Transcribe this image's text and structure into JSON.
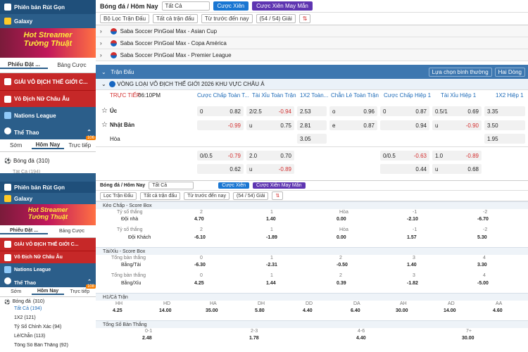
{
  "sidebar": {
    "promo": "Phiên bản Rút Gọn",
    "galaxy": "Galaxy",
    "banner_line1": "Hot Streamer",
    "banner_line2": "Tường Thuật",
    "slip_label": "Phiếu Đặt ...",
    "odds_table": "Bảng Cược",
    "menu": [
      "GIẢI VÔ ĐỊCH THẾ GIỚI C...",
      "Vô Địch Nữ Châu Âu",
      "Nations League",
      "Thể Thao"
    ],
    "subtabs": [
      "Sớm",
      "Hôm Nay",
      "Trực tiếp"
    ],
    "live_count": "106",
    "live_count2": "108",
    "sport": "Bóng đá",
    "sport_count": "(310)",
    "sport_count2": "(310)",
    "items": [
      "Tất Cả (194)",
      "1X2 (121)",
      "Tỷ Số Chính Xác (94)",
      "Lẻ/Chẵn (113)",
      "Tổng Số Bàn Thắng (92)"
    ],
    "item_partial": "Tất Cả (194)"
  },
  "toolbar": {
    "title": "Bóng đá / Hôm Nay",
    "market": "Tất Cả",
    "parlay": "Cược Xiên",
    "mix": "Cược Xiên May Mắn",
    "filter": "Bộ Lọc Trận Đấu",
    "all_matches": "Tất cả trận đấu",
    "time": "Từ trước đến nay",
    "count": "(54 / 54) Giải",
    "filter_small": "Lọc Trận Đấu",
    "all_small": "Tất cả trận đấu",
    "time_small": "Từ trước đến nay"
  },
  "leagues": [
    "Saba Soccer PinGoal Max - Asian Cup",
    "Saba Soccer PinGoal Max - Copa América",
    "Saba Soccer PinGoal Max - Premier League"
  ],
  "matches_bar": {
    "label": "Trận Đấu",
    "sort": "Lựa chọn bình thường",
    "view": "Hai Dòng"
  },
  "competition": "VÒNG LOẠI VÔ ĐỊCH THẾ GIỚI 2026 KHU VỰC CHÂU Á",
  "live": {
    "label": "TRỰC TIẾP",
    "time": "06:10PM"
  },
  "cols": [
    "Cược Chấp Toàn T...",
    "Tài Xỉu Toàn Trận",
    "1X2 Toàn...",
    "Chẵn Lẻ Toàn Trận",
    "Cược Chấp Hiệp 1",
    "Tài Xỉu Hiệp 1",
    "1X2 Hiệp 1"
  ],
  "teams": {
    "home": "Úc",
    "away": "Nhật Bản",
    "draw": "Hòa"
  },
  "row1": {
    "hcap": "0",
    "hv": "0.82",
    "ou": "2/2.5",
    "ouv": "-0.94",
    "x1": "2.53",
    "ol": "o",
    "olv": "0.96",
    "h1": "0",
    "h1v": "0.87",
    "ou1": "0.5/1",
    "ou1v": "0.69",
    "x11": "3.35"
  },
  "row2": {
    "hv": "-0.99",
    "ou": "u",
    "ouv": "0.75",
    "x1": "2.81",
    "ol": "e",
    "olv": "0.87",
    "h1v": "0.94",
    "ou1": "u",
    "ou1v": "-0.90",
    "x11": "3.50"
  },
  "row3": {
    "x1": "3.05",
    "x11": "1.95"
  },
  "row4": {
    "hcap": "0/0.5",
    "hv": "-0.79",
    "ou": "2.0",
    "ouv": "0.70",
    "h1": "0/0.5",
    "h1v": "-0.63",
    "ou1": "1.0",
    "ou1v": "-0.89"
  },
  "row5": {
    "hv": "0.62",
    "ou": "u",
    "ouv": "-0.89",
    "h1v": "0.44",
    "ou1": "u",
    "ou1v": "0.68"
  },
  "lower": {
    "keo": {
      "title": "Kèo Chấp - Score Box",
      "lbl": "Tỷ số thắng",
      "heads": [
        "2",
        "1",
        "Hòa",
        "-1",
        "-2"
      ],
      "home": "Đội nhà",
      "hv": [
        "4.70",
        "1.40",
        "0.00",
        "-2.10",
        "-6.70"
      ],
      "away": "Đội Khách",
      "heads2": [
        "2",
        "1",
        "Hòa",
        "-1",
        "-2"
      ],
      "av": [
        "-6.10",
        "-1.89",
        "0.00",
        "1.57",
        "5.30"
      ]
    },
    "taixiu": {
      "title": "Tài/Xỉu - Score Box",
      "lbl": "Tổng bàn thắng",
      "heads": [
        "0",
        "1",
        "2",
        "3",
        "4"
      ],
      "tai": "Bằng/Tài",
      "tv": [
        "-6.30",
        "-2.31",
        "-0.50",
        "1.40",
        "3.30"
      ],
      "heads2": [
        "0",
        "1",
        "2",
        "3",
        "4"
      ],
      "xiu": "Bằng/Xỉu",
      "xv": [
        "4.25",
        "1.44",
        "0.39",
        "-1.82",
        "-5.00"
      ]
    },
    "h1": {
      "title": "H1/Cả Trận",
      "heads": [
        "HH",
        "HD",
        "HA",
        "DH",
        "DD",
        "DA",
        "AH",
        "AD",
        "AA"
      ],
      "vals": [
        "4.25",
        "14.00",
        "35.00",
        "5.80",
        "4.40",
        "6.40",
        "30.00",
        "14.00",
        "4.60"
      ]
    },
    "tsbt": {
      "title": "Tổng Số Bàn Thắng",
      "heads": [
        "0-1",
        "2-3",
        "4-6",
        "7+"
      ],
      "vals": [
        "2.48",
        "1.78",
        "4.40",
        "30.00"
      ]
    }
  }
}
